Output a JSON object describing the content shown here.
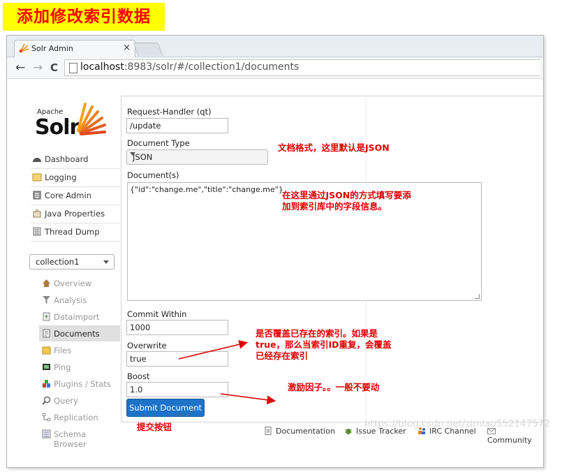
{
  "banner": "添加修改索引数据",
  "browser": {
    "tab_title": "Solr Admin",
    "tab_close": "×",
    "back": "←",
    "forward": "→",
    "reload": "C",
    "url_host": "localhost",
    "url_rest": ":8983/solr/#/collection1/documents"
  },
  "logo": {
    "apache": "Apache",
    "solr": "Solr"
  },
  "nav": [
    {
      "label": "Dashboard",
      "icon": "dashboard-icon"
    },
    {
      "label": "Logging",
      "icon": "logging-icon"
    },
    {
      "label": "Core Admin",
      "icon": "core-admin-icon"
    },
    {
      "label": "Java Properties",
      "icon": "java-properties-icon"
    },
    {
      "label": "Thread Dump",
      "icon": "thread-dump-icon"
    }
  ],
  "core_selector": {
    "value": "collection1"
  },
  "core_nav": [
    {
      "label": "Overview",
      "icon": "overview-icon"
    },
    {
      "label": "Analysis",
      "icon": "analysis-icon"
    },
    {
      "label": "Dataimport",
      "icon": "dataimport-icon"
    },
    {
      "label": "Documents",
      "icon": "documents-icon",
      "active": true
    },
    {
      "label": "Files",
      "icon": "files-icon"
    },
    {
      "label": "Ping",
      "icon": "ping-icon"
    },
    {
      "label": "Plugins / Stats",
      "icon": "plugins-icon"
    },
    {
      "label": "Query",
      "icon": "query-icon"
    },
    {
      "label": "Replication",
      "icon": "replication-icon"
    },
    {
      "label": "Schema Browser",
      "icon": "schema-browser-icon"
    }
  ],
  "form": {
    "request_handler_label": "Request-Handler (qt)",
    "request_handler_value": "/update",
    "doc_type_label": "Document Type",
    "doc_type_value": "JSON",
    "documents_label": "Document(s)",
    "documents_value": "{\"id\":\"change.me\",\"title\":\"change.me\"}",
    "commit_within_label": "Commit Within",
    "commit_within_value": "1000",
    "overwrite_label": "Overwrite",
    "overwrite_value": "true",
    "boost_label": "Boost",
    "boost_value": "1.0",
    "submit_label": "Submit Document"
  },
  "annotations": {
    "doc_type": "文档格式，这里默认是JSON",
    "documents_line1": "在这里通过JSON的方式填写要添",
    "documents_line2": "加到索引库中的字段信息。",
    "overwrite_line1": "是否覆盖已存在的索引。如果是",
    "overwrite_line2": "true，那么当索引ID重复，会覆盖",
    "overwrite_line3": "已经存在索引",
    "boost": "激励因子。。一般不要动",
    "submit": "提交按钮"
  },
  "footer": {
    "documentation": "Documentation",
    "issue_tracker": "Issue Tracker",
    "irc_channel": "IRC Channel",
    "community": "Community"
  },
  "watermark": "https://blog.csdn.net/zimiao552147572",
  "colors": {
    "annotation": "#e00000",
    "banner_bg": "#ffff00",
    "submit_bg": "#1d73c8"
  }
}
